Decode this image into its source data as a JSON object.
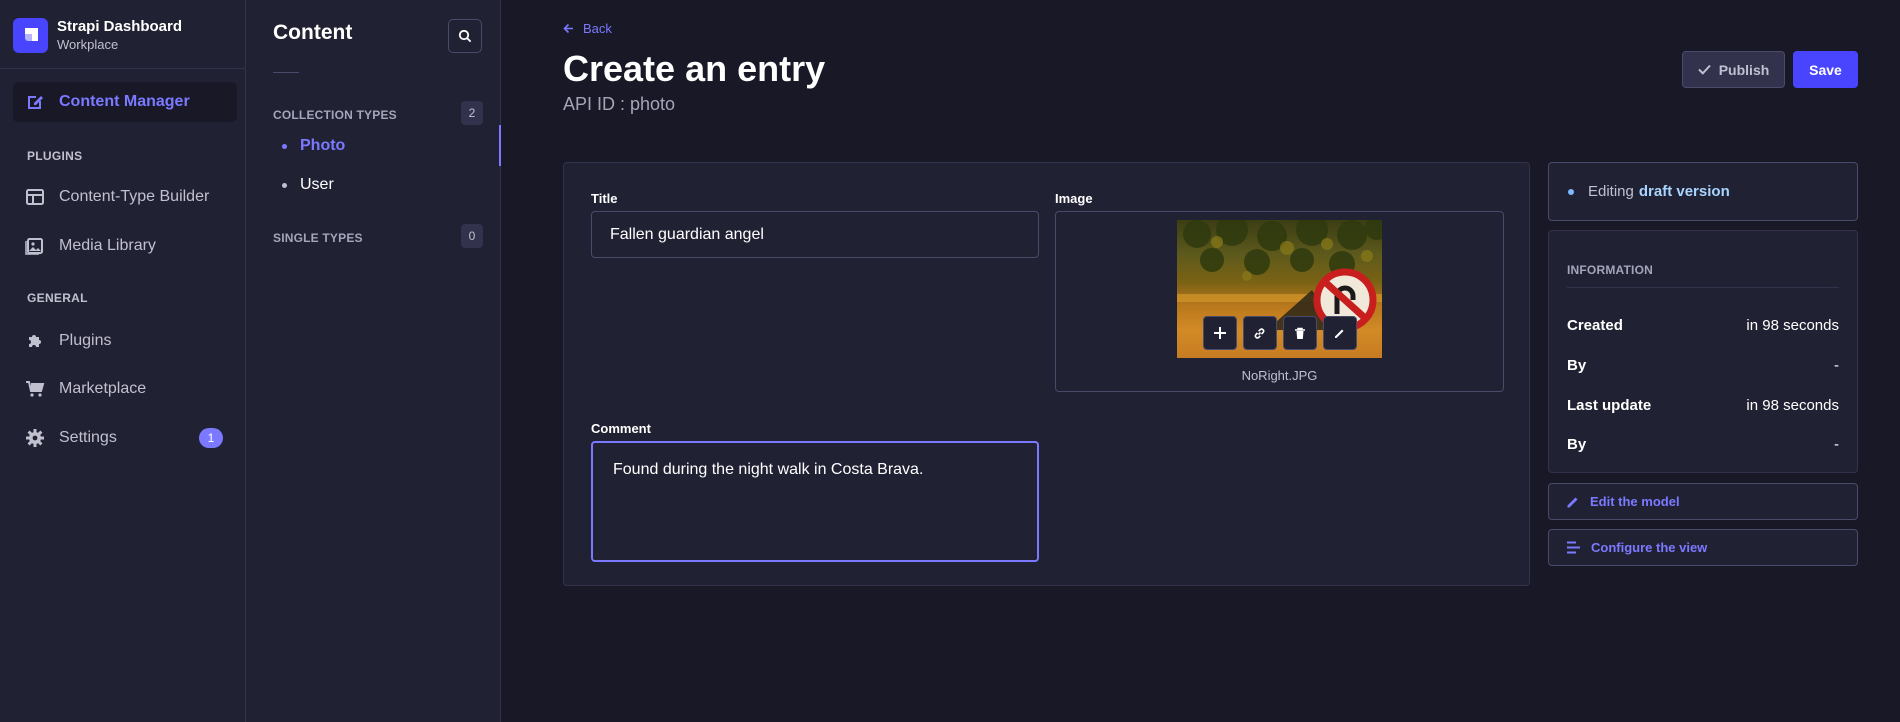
{
  "brand": {
    "title": "Strapi Dashboard",
    "subtitle": "Workplace"
  },
  "mainnav": {
    "items": [
      {
        "label": "Content Manager",
        "icon": "content-manager-icon",
        "active": true
      },
      {
        "label": "Content-Type Builder",
        "icon": "layout-icon"
      },
      {
        "label": "Media Library",
        "icon": "image-icon"
      },
      {
        "label": "Plugins",
        "icon": "puzzle-icon"
      },
      {
        "label": "Marketplace",
        "icon": "cart-icon"
      },
      {
        "label": "Settings",
        "icon": "gear-icon",
        "badge": "1"
      }
    ],
    "sections": {
      "plugins": "PLUGINS",
      "general": "GENERAL"
    }
  },
  "subnav": {
    "title": "Content",
    "collection_types": {
      "label": "COLLECTION TYPES",
      "count": "2",
      "items": [
        "Photo",
        "User"
      ]
    },
    "single_types": {
      "label": "SINGLE TYPES",
      "count": "0"
    }
  },
  "header": {
    "back": "Back",
    "title": "Create an entry",
    "api_id": "API ID : photo",
    "publish": "Publish",
    "save": "Save"
  },
  "form": {
    "title_label": "Title",
    "title_value": "Fallen guardian angel",
    "image_label": "Image",
    "image_filename": "NoRight.JPG",
    "comment_label": "Comment",
    "comment_value": "Found during the night walk in Costa Brava."
  },
  "sidebar": {
    "status_prefix": "Editing",
    "status_value": "draft version",
    "info_title": "INFORMATION",
    "rows": [
      {
        "key": "Created",
        "value": "in 98 seconds"
      },
      {
        "key": "By",
        "value": "-"
      },
      {
        "key": "Last update",
        "value": "in 98 seconds"
      },
      {
        "key": "By",
        "value": "-"
      }
    ],
    "edit_model": "Edit the model",
    "configure_view": "Configure the view"
  },
  "colors": {
    "accent": "#7b79ff",
    "primary": "#4945ff",
    "background": "#181826",
    "surface": "#212134"
  }
}
